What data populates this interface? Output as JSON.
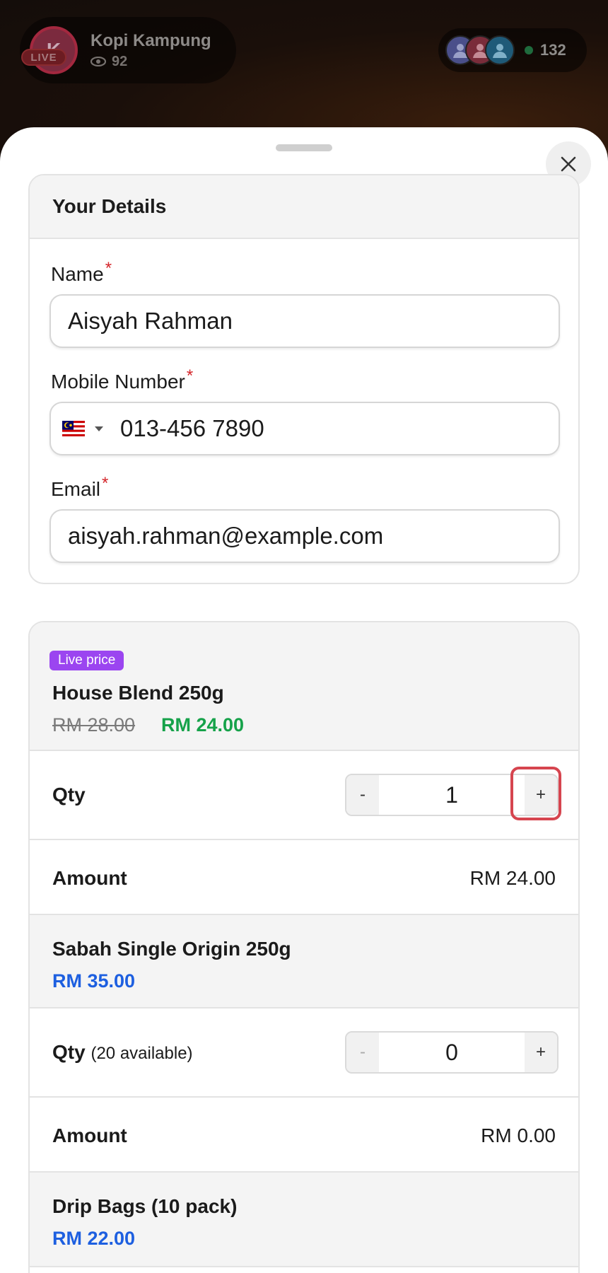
{
  "header": {
    "host_initial": "K",
    "live_label": "LIVE",
    "host_name": "Kopi Kampung",
    "views": "92",
    "viewer_count": "132"
  },
  "details": {
    "title": "Your Details",
    "name_label": "Name",
    "name_value": "Aisyah Rahman",
    "mobile_label": "Mobile Number",
    "country_flag": "malaysia-flag",
    "mobile_value": "013-456 7890",
    "email_label": "Email",
    "email_value": "aisyah.rahman@example.com",
    "required_mark": "*"
  },
  "products": [
    {
      "badge": "Live price",
      "name": "House Blend 250g",
      "old_price": "RM 28.00",
      "price": "RM 24.00",
      "qty_label": "Qty",
      "qty": "1",
      "amount_label": "Amount",
      "amount": "RM 24.00"
    },
    {
      "name": "Sabah Single Origin 250g",
      "price": "RM 35.00",
      "qty_label": "Qty",
      "availability": "(20 available)",
      "qty": "0",
      "amount_label": "Amount",
      "amount": "RM 0.00"
    },
    {
      "name": "Drip Bags (10 pack)",
      "price": "RM 22.00"
    }
  ],
  "stepper": {
    "minus": "-",
    "plus": "+"
  },
  "colors": {
    "live_badge": "#9b45f0",
    "discount_price": "#16a24a",
    "price_blue": "#1d5fe0",
    "required": "#d4262b",
    "highlight": "#d6454f"
  }
}
